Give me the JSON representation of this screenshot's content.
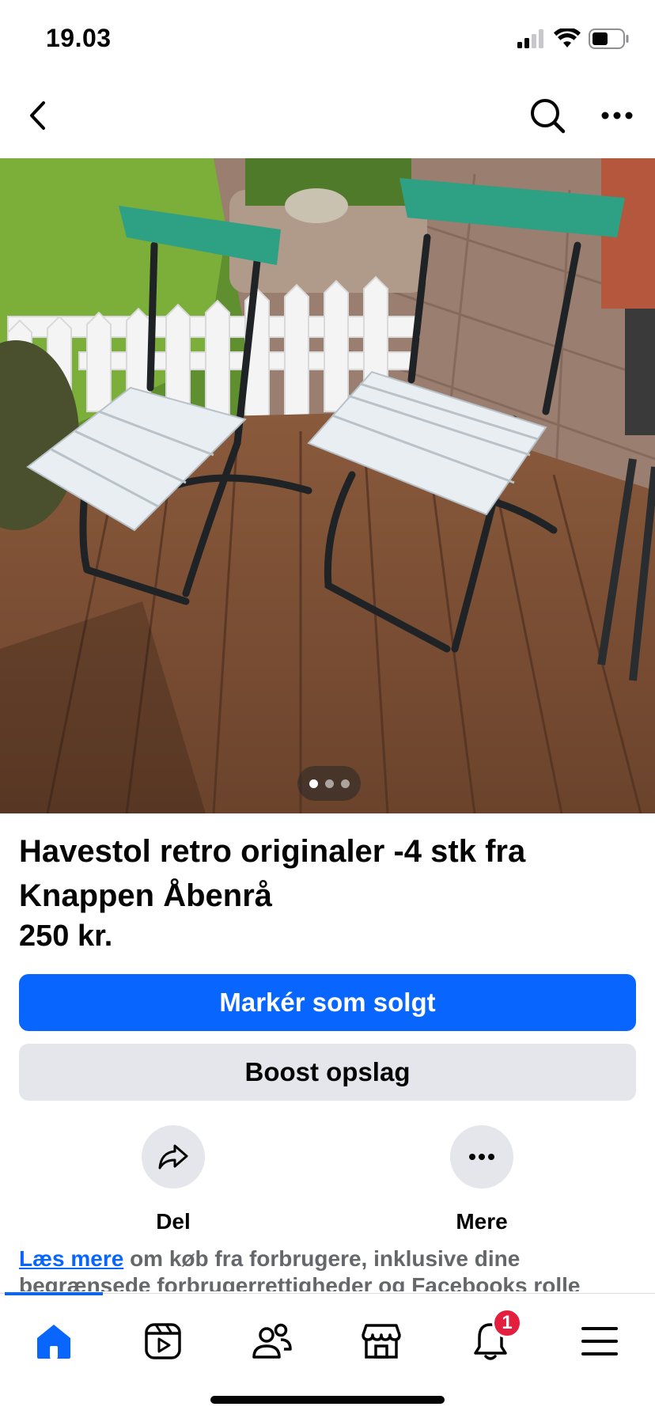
{
  "status": {
    "time": "19.03"
  },
  "nav": {
    "back_icon": "chevron-left-icon",
    "search_icon": "search-icon",
    "more_icon": "more-horizontal-icon"
  },
  "listing": {
    "photo_count": 3,
    "active_photo": 1,
    "title": "Havestol retro  originaler -4 stk fra Knappen Åbenrå",
    "price": "250 kr."
  },
  "buttons": {
    "primary_label": "Markér som solgt",
    "secondary_label": "Boost opslag"
  },
  "actions": [
    {
      "label": "Del",
      "icon": "share-icon"
    },
    {
      "label": "Mere",
      "icon": "more-horizontal-icon"
    }
  ],
  "disclaimer": {
    "link_text": "Læs mere",
    "text": " om køb fra forbrugere, inklusive dine begrænsede forbrugerrettigheder og Facebooks rolle"
  },
  "tabbar": {
    "tabs": [
      {
        "name": "home",
        "icon": "home-icon",
        "active": true
      },
      {
        "name": "video",
        "icon": "video-icon"
      },
      {
        "name": "friends",
        "icon": "friends-icon"
      },
      {
        "name": "marketplace",
        "icon": "marketplace-icon"
      },
      {
        "name": "notifications",
        "icon": "bell-icon",
        "badge": "1"
      },
      {
        "name": "menu",
        "icon": "menu-icon"
      }
    ],
    "notification_badge": "1"
  },
  "colors": {
    "accent": "#0866ff",
    "secondary_button": "#e4e6eb",
    "badge": "#e41e3f"
  }
}
